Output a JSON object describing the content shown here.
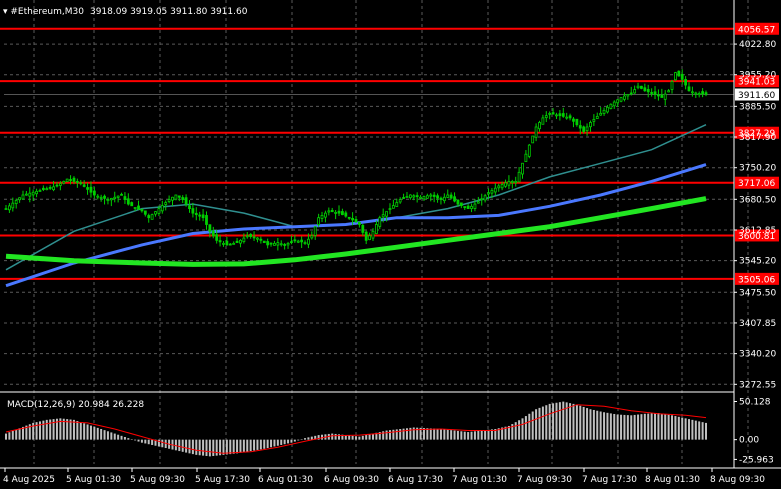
{
  "header": {
    "symbol_timeframe": "#Ethereum,M30",
    "ohlc": "3918.09 3919.05 3911.80 3911.60"
  },
  "macd_header": "MACD(12,26,9) 20.984 26.228",
  "colors": {
    "background": "#000000",
    "grid": "#5a5a5a",
    "candle": "#00d000",
    "level_line": "#ff0000",
    "level_label_bg": "#ff0000",
    "ma_fast": "#2f8f8f",
    "ma_mid": "#4a78ff",
    "ma_slow": "#22e622",
    "macd_hist": "#c0c0c0",
    "macd_signal": "#ff0000",
    "price_label_bg": "#ffffff"
  },
  "chart_data": {
    "type": "candlestick",
    "instrument": "#Ethereum",
    "timeframe": "M30",
    "price_axis_ticks": [
      "4022.80",
      "3955.20",
      "3885.50",
      "3817.90",
      "3750.20",
      "3680.50",
      "3612.85",
      "3545.20",
      "3475.50",
      "3407.85",
      "3340.20",
      "3272.55"
    ],
    "price_axis_values": [
      4022.8,
      3955.2,
      3885.5,
      3817.9,
      3750.2,
      3680.5,
      3612.85,
      3545.2,
      3475.5,
      3407.85,
      3340.2,
      3272.55
    ],
    "ylim": [
      3260,
      4120
    ],
    "current_price": "3911.60",
    "current_price_value": 3911.6,
    "levels": [
      {
        "label": "4056.57",
        "value": 4056.57
      },
      {
        "label": "3941.03",
        "value": 3941.03
      },
      {
        "label": "3827.29",
        "value": 3827.29
      },
      {
        "label": "3717.06",
        "value": 3717.06
      },
      {
        "label": "3600.81",
        "value": 3600.81
      },
      {
        "label": "3505.06",
        "value": 3505.06
      }
    ],
    "time_labels": [
      "4 Aug 2025",
      "5 Aug 01:30",
      "5 Aug 09:30",
      "5 Aug 17:30",
      "6 Aug 01:30",
      "6 Aug 09:30",
      "6 Aug 17:30",
      "7 Aug 01:30",
      "7 Aug 09:30",
      "7 Aug 17:30",
      "8 Aug 01:30",
      "8 Aug 09:30"
    ],
    "price_path": [
      [
        0,
        3660
      ],
      [
        5,
        3690
      ],
      [
        10,
        3700
      ],
      [
        15,
        3710
      ],
      [
        18,
        3725
      ],
      [
        22,
        3715
      ],
      [
        26,
        3690
      ],
      [
        30,
        3680
      ],
      [
        34,
        3690
      ],
      [
        36,
        3670
      ],
      [
        40,
        3655
      ],
      [
        42,
        3640
      ],
      [
        45,
        3660
      ],
      [
        48,
        3680
      ],
      [
        50,
        3690
      ],
      [
        52,
        3680
      ],
      [
        55,
        3650
      ],
      [
        58,
        3640
      ],
      [
        60,
        3610
      ],
      [
        62,
        3590
      ],
      [
        65,
        3580
      ],
      [
        68,
        3585
      ],
      [
        71,
        3600
      ],
      [
        74,
        3595
      ],
      [
        77,
        3580
      ],
      [
        80,
        3585
      ],
      [
        82,
        3580
      ],
      [
        85,
        3590
      ],
      [
        88,
        3585
      ],
      [
        90,
        3600
      ],
      [
        92,
        3640
      ],
      [
        95,
        3655
      ],
      [
        98,
        3650
      ],
      [
        101,
        3640
      ],
      [
        104,
        3625
      ],
      [
        106,
        3590
      ],
      [
        108,
        3610
      ],
      [
        110,
        3640
      ],
      [
        113,
        3660
      ],
      [
        116,
        3680
      ],
      [
        119,
        3690
      ],
      [
        122,
        3685
      ],
      [
        125,
        3690
      ],
      [
        128,
        3680
      ],
      [
        130,
        3690
      ],
      [
        133,
        3670
      ],
      [
        136,
        3660
      ],
      [
        139,
        3675
      ],
      [
        142,
        3695
      ],
      [
        145,
        3710
      ],
      [
        148,
        3720
      ],
      [
        150,
        3720
      ],
      [
        152,
        3760
      ],
      [
        154,
        3800
      ],
      [
        156,
        3840
      ],
      [
        158,
        3860
      ],
      [
        160,
        3870
      ],
      [
        163,
        3865
      ],
      [
        166,
        3860
      ],
      [
        168,
        3845
      ],
      [
        170,
        3830
      ],
      [
        172,
        3850
      ],
      [
        175,
        3870
      ],
      [
        178,
        3890
      ],
      [
        181,
        3905
      ],
      [
        184,
        3915
      ],
      [
        186,
        3930
      ],
      [
        188,
        3920
      ],
      [
        190,
        3915
      ],
      [
        193,
        3905
      ],
      [
        195,
        3920
      ],
      [
        197,
        3960
      ],
      [
        199,
        3945
      ],
      [
        201,
        3920
      ],
      [
        203,
        3915
      ],
      [
        206,
        3912
      ]
    ],
    "ma_fast": [
      [
        0,
        3525
      ],
      [
        20,
        3610
      ],
      [
        40,
        3660
      ],
      [
        55,
        3670
      ],
      [
        70,
        3650
      ],
      [
        85,
        3620
      ],
      [
        100,
        3625
      ],
      [
        115,
        3640
      ],
      [
        130,
        3660
      ],
      [
        145,
        3690
      ],
      [
        160,
        3730
      ],
      [
        175,
        3760
      ],
      [
        190,
        3790
      ],
      [
        206,
        3845
      ]
    ],
    "ma_mid": [
      [
        0,
        3490
      ],
      [
        20,
        3540
      ],
      [
        40,
        3580
      ],
      [
        55,
        3605
      ],
      [
        70,
        3615
      ],
      [
        85,
        3620
      ],
      [
        100,
        3625
      ],
      [
        115,
        3640
      ],
      [
        130,
        3640
      ],
      [
        145,
        3645
      ],
      [
        160,
        3665
      ],
      [
        175,
        3690
      ],
      [
        190,
        3720
      ],
      [
        206,
        3757
      ]
    ],
    "ma_slow": [
      [
        0,
        3555
      ],
      [
        20,
        3545
      ],
      [
        40,
        3540
      ],
      [
        55,
        3537
      ],
      [
        70,
        3538
      ],
      [
        85,
        3547
      ],
      [
        100,
        3560
      ],
      [
        115,
        3575
      ],
      [
        130,
        3590
      ],
      [
        145,
        3605
      ],
      [
        160,
        3620
      ],
      [
        175,
        3640
      ],
      [
        190,
        3660
      ],
      [
        206,
        3682
      ]
    ],
    "macd": {
      "ticks": [
        "50.128",
        "0.00",
        "-25.963"
      ],
      "tick_values": [
        50.128,
        0.0,
        -25.963
      ],
      "ylim": [
        -32,
        60
      ],
      "hist": [
        [
          0,
          8
        ],
        [
          4,
          15
        ],
        [
          8,
          22
        ],
        [
          12,
          26
        ],
        [
          16,
          28
        ],
        [
          20,
          26
        ],
        [
          24,
          20
        ],
        [
          28,
          14
        ],
        [
          32,
          8
        ],
        [
          36,
          2
        ],
        [
          40,
          -4
        ],
        [
          44,
          -8
        ],
        [
          48,
          -12
        ],
        [
          52,
          -16
        ],
        [
          56,
          -20
        ],
        [
          60,
          -22
        ],
        [
          64,
          -20
        ],
        [
          68,
          -18
        ],
        [
          72,
          -15
        ],
        [
          76,
          -12
        ],
        [
          80,
          -8
        ],
        [
          84,
          -4
        ],
        [
          88,
          2
        ],
        [
          92,
          6
        ],
        [
          96,
          8
        ],
        [
          100,
          6
        ],
        [
          104,
          4
        ],
        [
          108,
          8
        ],
        [
          112,
          12
        ],
        [
          116,
          14
        ],
        [
          120,
          16
        ],
        [
          124,
          15
        ],
        [
          128,
          14
        ],
        [
          132,
          12
        ],
        [
          136,
          10
        ],
        [
          140,
          12
        ],
        [
          144,
          14
        ],
        [
          148,
          18
        ],
        [
          152,
          28
        ],
        [
          156,
          40
        ],
        [
          160,
          47
        ],
        [
          164,
          50
        ],
        [
          168,
          46
        ],
        [
          172,
          40
        ],
        [
          176,
          36
        ],
        [
          180,
          33
        ],
        [
          184,
          32
        ],
        [
          188,
          34
        ],
        [
          192,
          35
        ],
        [
          196,
          32
        ],
        [
          200,
          28
        ],
        [
          206,
          22
        ]
      ],
      "signal": [
        [
          0,
          10
        ],
        [
          8,
          18
        ],
        [
          16,
          24
        ],
        [
          24,
          22
        ],
        [
          32,
          14
        ],
        [
          40,
          4
        ],
        [
          48,
          -6
        ],
        [
          56,
          -14
        ],
        [
          64,
          -18
        ],
        [
          72,
          -16
        ],
        [
          80,
          -10
        ],
        [
          88,
          -2
        ],
        [
          96,
          5
        ],
        [
          104,
          6
        ],
        [
          112,
          9
        ],
        [
          120,
          13
        ],
        [
          128,
          14
        ],
        [
          136,
          12
        ],
        [
          144,
          12
        ],
        [
          152,
          20
        ],
        [
          160,
          34
        ],
        [
          168,
          46
        ],
        [
          176,
          44
        ],
        [
          184,
          38
        ],
        [
          192,
          34
        ],
        [
          200,
          32
        ],
        [
          206,
          29
        ]
      ]
    }
  }
}
